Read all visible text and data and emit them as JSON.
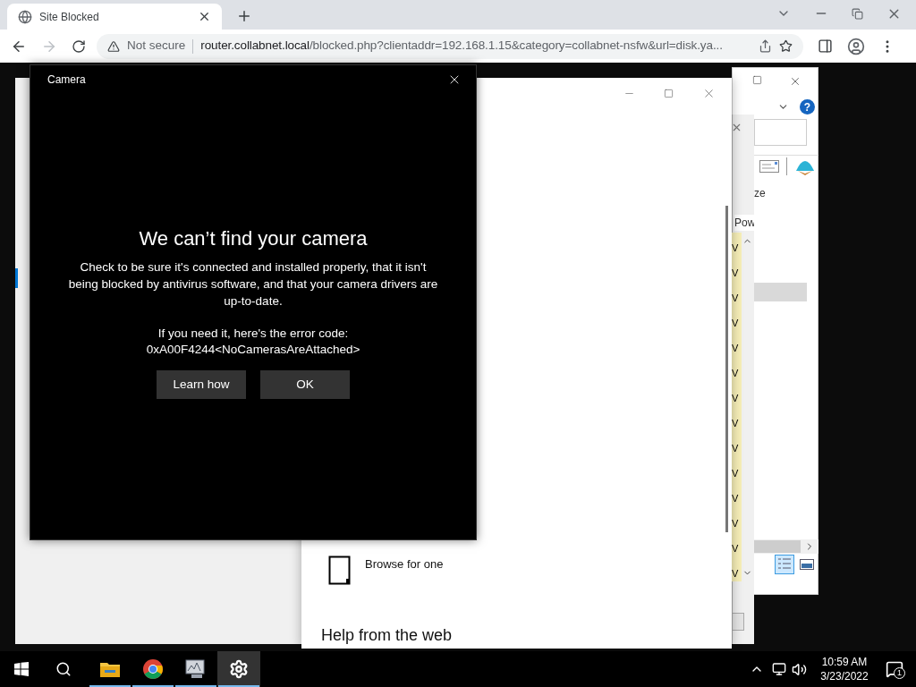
{
  "browser": {
    "tab": {
      "title": "Site Blocked",
      "selected": true
    },
    "security": "Not secure",
    "url_host": "router.collabnet.local",
    "url_path": "/blocked.php?clientaddr=192.168.1.15&category=collabnet-nsfw&url=disk.ya..."
  },
  "camera_dialog": {
    "title": "Camera",
    "heading": "We can’t find your camera",
    "message": "Check to be sure it's connected and installed properly, that it isn't being blocked by antivirus software, and that your camera drivers are up-to-date.",
    "error_intro": "If you need it, here's the error code:",
    "error_code": "0xA00F4244<NoCamerasAreAttached>",
    "buttons": [
      "Learn how",
      "OK"
    ]
  },
  "settings_window": {
    "option": "Browse for one",
    "section": "Help from the web"
  },
  "explorer_window": {
    "column": "ze",
    "help_glyph": "?"
  },
  "list_window": {
    "column": "Pow",
    "rows": [
      "V",
      "V",
      "V",
      "V",
      "V",
      "V",
      "V",
      "V",
      "V",
      "V",
      "V",
      "V",
      "V",
      "V"
    ]
  },
  "taskbar": {
    "apps": [
      {
        "kind": "folder",
        "selected": false
      },
      {
        "kind": "chrome",
        "selected": false
      },
      {
        "kind": "monitor",
        "selected": false
      },
      {
        "kind": "settings",
        "selected": true
      }
    ],
    "time": "10:59 AM",
    "date": "3/23/2022",
    "notifications": "1"
  }
}
